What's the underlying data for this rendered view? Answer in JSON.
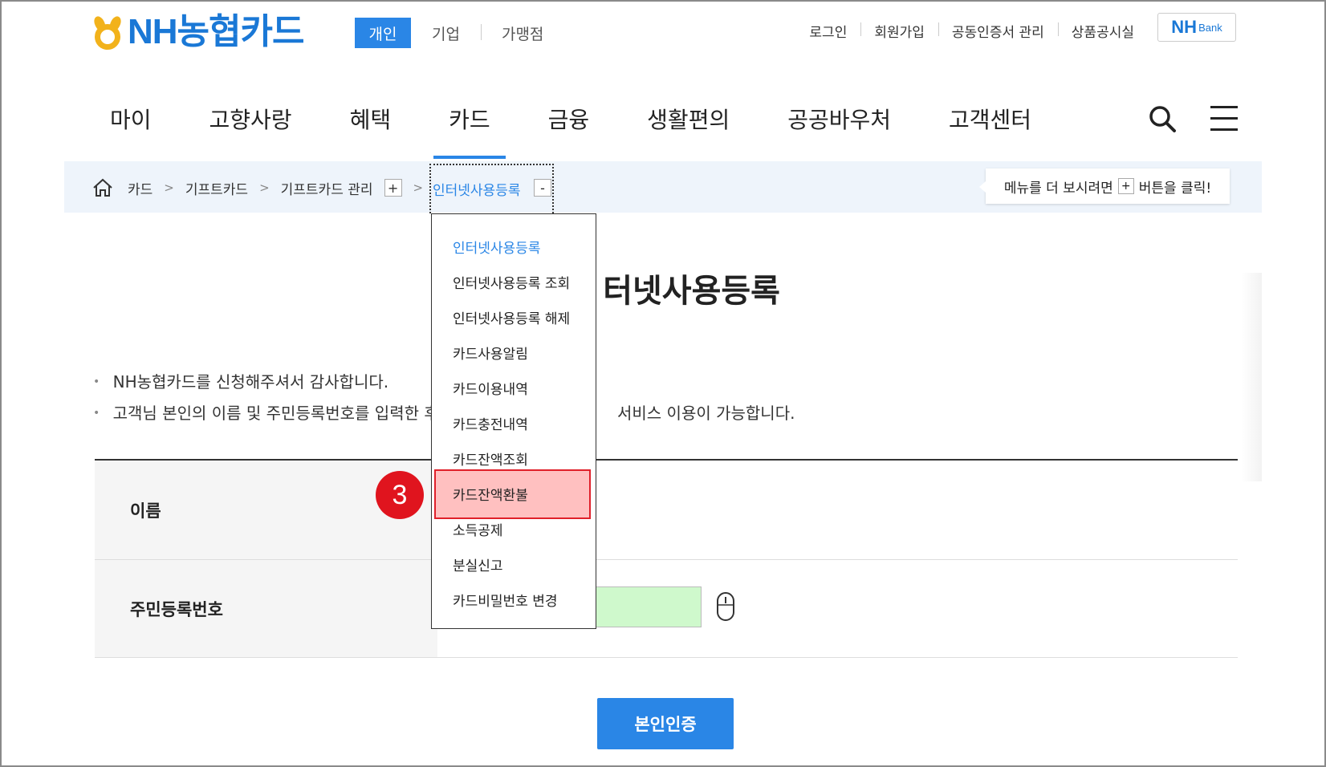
{
  "brand": {
    "logo_text": "NH농협카드",
    "accent": "#2a86e6",
    "highlight": "#e0141e"
  },
  "segments": [
    "개인",
    "기업",
    "가맹점"
  ],
  "util_links": [
    "로그인",
    "회원가입",
    "공동인증서 관리",
    "상품공시실"
  ],
  "nhbank": {
    "main": "NH",
    "sub": "Bank"
  },
  "gnb": [
    "마이",
    "고향사랑",
    "혜택",
    "카드",
    "금융",
    "생활편의",
    "공공바우처",
    "고객센터"
  ],
  "gnb_active": "카드",
  "breadcrumb": {
    "items": [
      "카드",
      "기프트카드",
      "기프트카드 관리"
    ],
    "sep": ">",
    "current": "인터넷사용등록",
    "plus": "+",
    "minus": "-"
  },
  "tip": {
    "before": "메뉴를 더 보시려면",
    "plus": "+",
    "after": "버튼을 클릭!"
  },
  "page_title": "터넷사용등록",
  "notices": [
    {
      "a": "NH농협카드를 신청해주셔서 감사합니다.",
      "b": ""
    },
    {
      "a": "고객님 본인의 이름 및 주민등록번호를 입력한 후",
      "b": "서비스 이용이 가능합니다."
    }
  ],
  "form": {
    "name_label": "이름",
    "rrn_label": "주민등록번호"
  },
  "auth_button": "본인인증",
  "dropdown": [
    "인터넷사용등록",
    "인터넷사용등록 조회",
    "인터넷사용등록 해제",
    "카드사용알림",
    "카드이용내역",
    "카드충전내역",
    "카드잔액조회",
    "카드잔액환불",
    "소득공제",
    "분실신고",
    "카드비밀번호 변경"
  ],
  "step_badge": "3",
  "icons": [
    "home-icon",
    "search-icon",
    "hamburger-menu-icon",
    "mouse-icon"
  ]
}
